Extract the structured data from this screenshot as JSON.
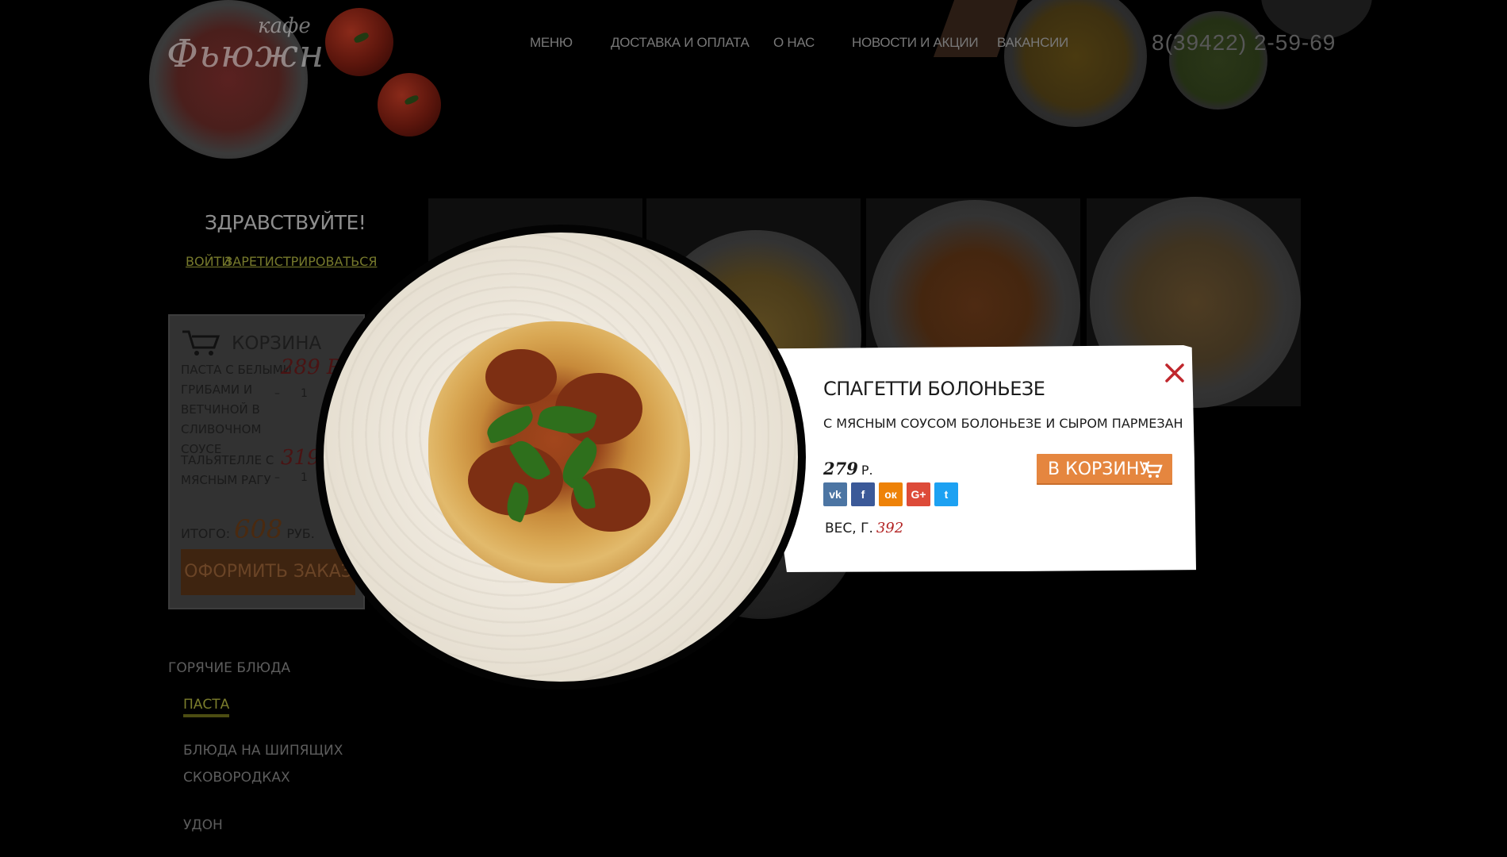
{
  "colors": {
    "page_bg": "#000000",
    "accent_orange": "#e5863f",
    "price_red": "#b32323",
    "close_red": "#c0272d",
    "active_category": "#7b7d2c"
  },
  "header": {
    "logo_line1": "кафе",
    "logo_line2": "Фьюжн",
    "nav": [
      "МЕНЮ",
      "ДОСТАВКА И ОПЛАТА",
      "О НАС",
      "НОВОСТИ И АКЦИИ",
      "ВАКАНСИИ"
    ],
    "phone": "8(39422) 2-59-69"
  },
  "sidebar": {
    "greeting": "ЗДРАВСТВУЙТЕ!",
    "login_link": "ВОЙТИ",
    "register_link": "ЗАРЕТИСТРИРОВАТЬСЯ",
    "cart": {
      "title": "КОРЗИНА",
      "icon": "shopping-cart-icon",
      "items": [
        {
          "name": "ПАСТА С БЕЛЫМИ ГРИБАМИ И ВЕТЧИНОЙ В СЛИВОЧНОМ СОУСЕ",
          "price": "289 Р",
          "qty_minus": "–",
          "qty": "1"
        },
        {
          "name": "ТАЛЬЯТЕЛЛЕ С МЯСНЫМ РАГУ",
          "price": "319",
          "qty_minus": "–",
          "qty": "1"
        }
      ],
      "total_label": "ИТОГО:",
      "total_value": "608",
      "total_currency": "РУБ.",
      "order_button": "ОФОРМИТЬ ЗАКАЗ"
    },
    "categories": [
      {
        "label": "ГОРЯЧИЕ БЛЮДА",
        "level": 0,
        "active": false
      },
      {
        "label": "ПАСТА",
        "level": 1,
        "active": true
      },
      {
        "label": "БЛЮДА НА ШИПЯЩИХ",
        "level": 1,
        "active": false
      },
      {
        "label": "СКОВОРОДКАХ",
        "level": 1,
        "active": false
      },
      {
        "label": "УДОН",
        "level": 1,
        "active": false
      }
    ]
  },
  "modal": {
    "title": "СПАГЕТТИ БОЛОНЬЕЗЕ",
    "description": "С МЯСНЫМ СОУСОМ БОЛОНЬЕЗЕ И СЫРОМ ПАРМЕЗАН",
    "price": "279",
    "currency": "Р.",
    "weight_label": "ВЕС, Г.",
    "weight_value": "392",
    "add_to_cart": "В КОРЗИНУ",
    "close_icon": "close-icon",
    "social": [
      {
        "name": "vk-icon",
        "glyph": "vk",
        "color": "#4c75a3"
      },
      {
        "name": "facebook-icon",
        "glyph": "f",
        "color": "#3b5998"
      },
      {
        "name": "odnoklassniki-icon",
        "glyph": "ок",
        "color": "#ee8208"
      },
      {
        "name": "google-plus-icon",
        "glyph": "G+",
        "color": "#dd4b39"
      },
      {
        "name": "twitter-icon",
        "glyph": "t",
        "color": "#1da1f2"
      }
    ]
  }
}
